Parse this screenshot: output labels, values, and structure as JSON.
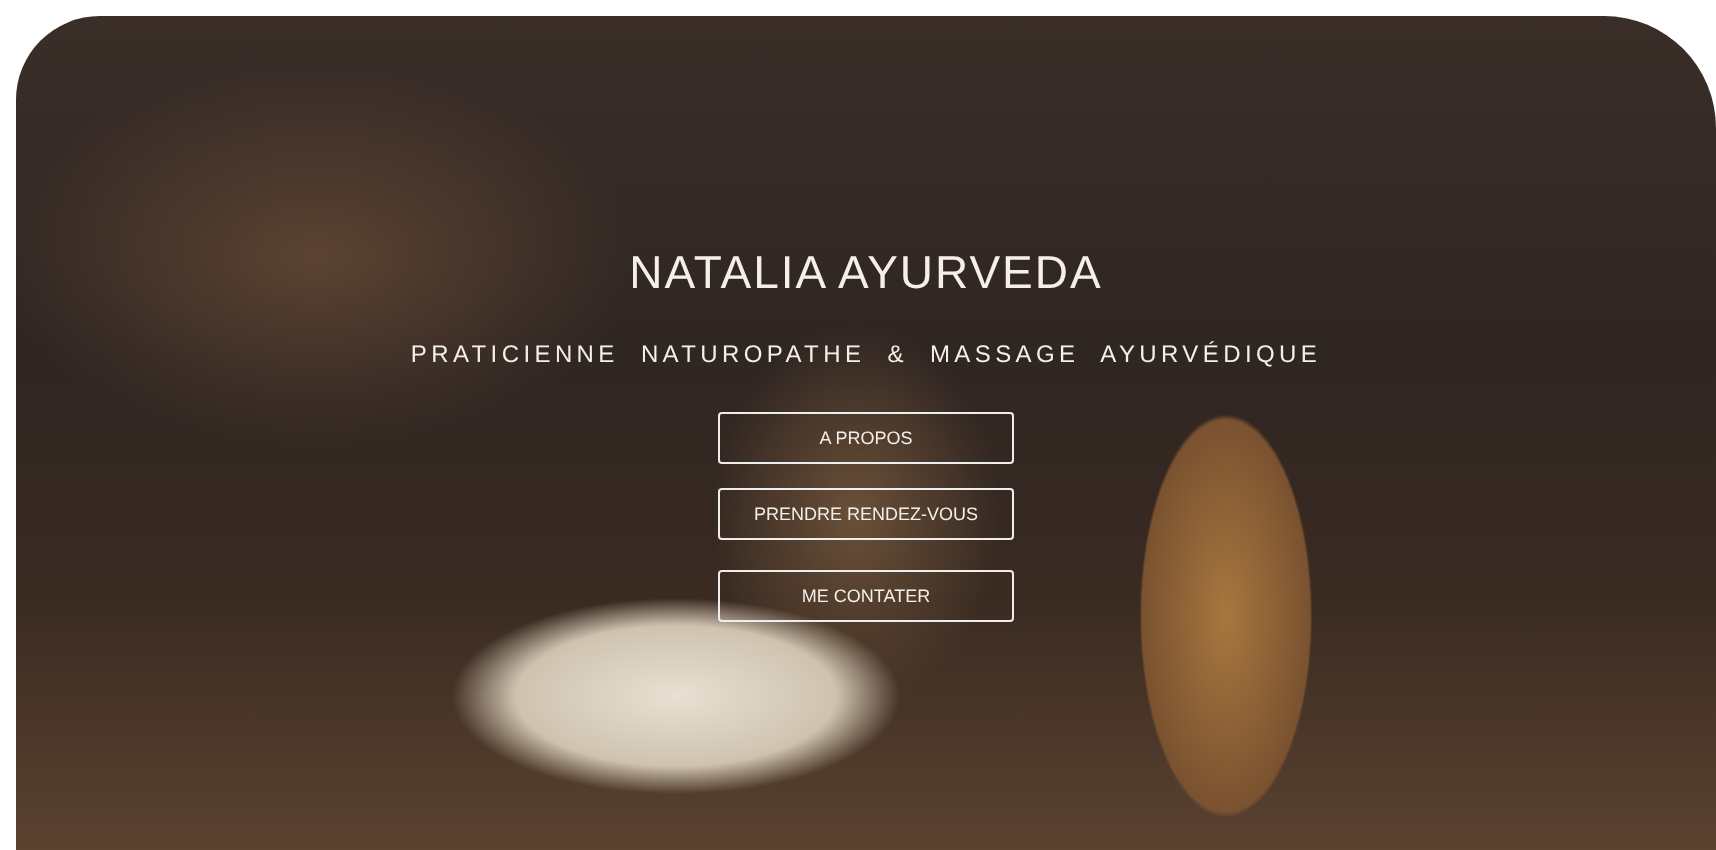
{
  "hero": {
    "title": "NATALIA AYURVEDA",
    "subtitle": "PRATICIENNE  NATUROPATHE  &  MASSAGE  AYURVÉDIQUE",
    "buttons": [
      {
        "label": "A PROPOS"
      },
      {
        "label": "PRENDRE RENDEZ-VOUS"
      },
      {
        "label": "ME CONTATER"
      }
    ]
  }
}
